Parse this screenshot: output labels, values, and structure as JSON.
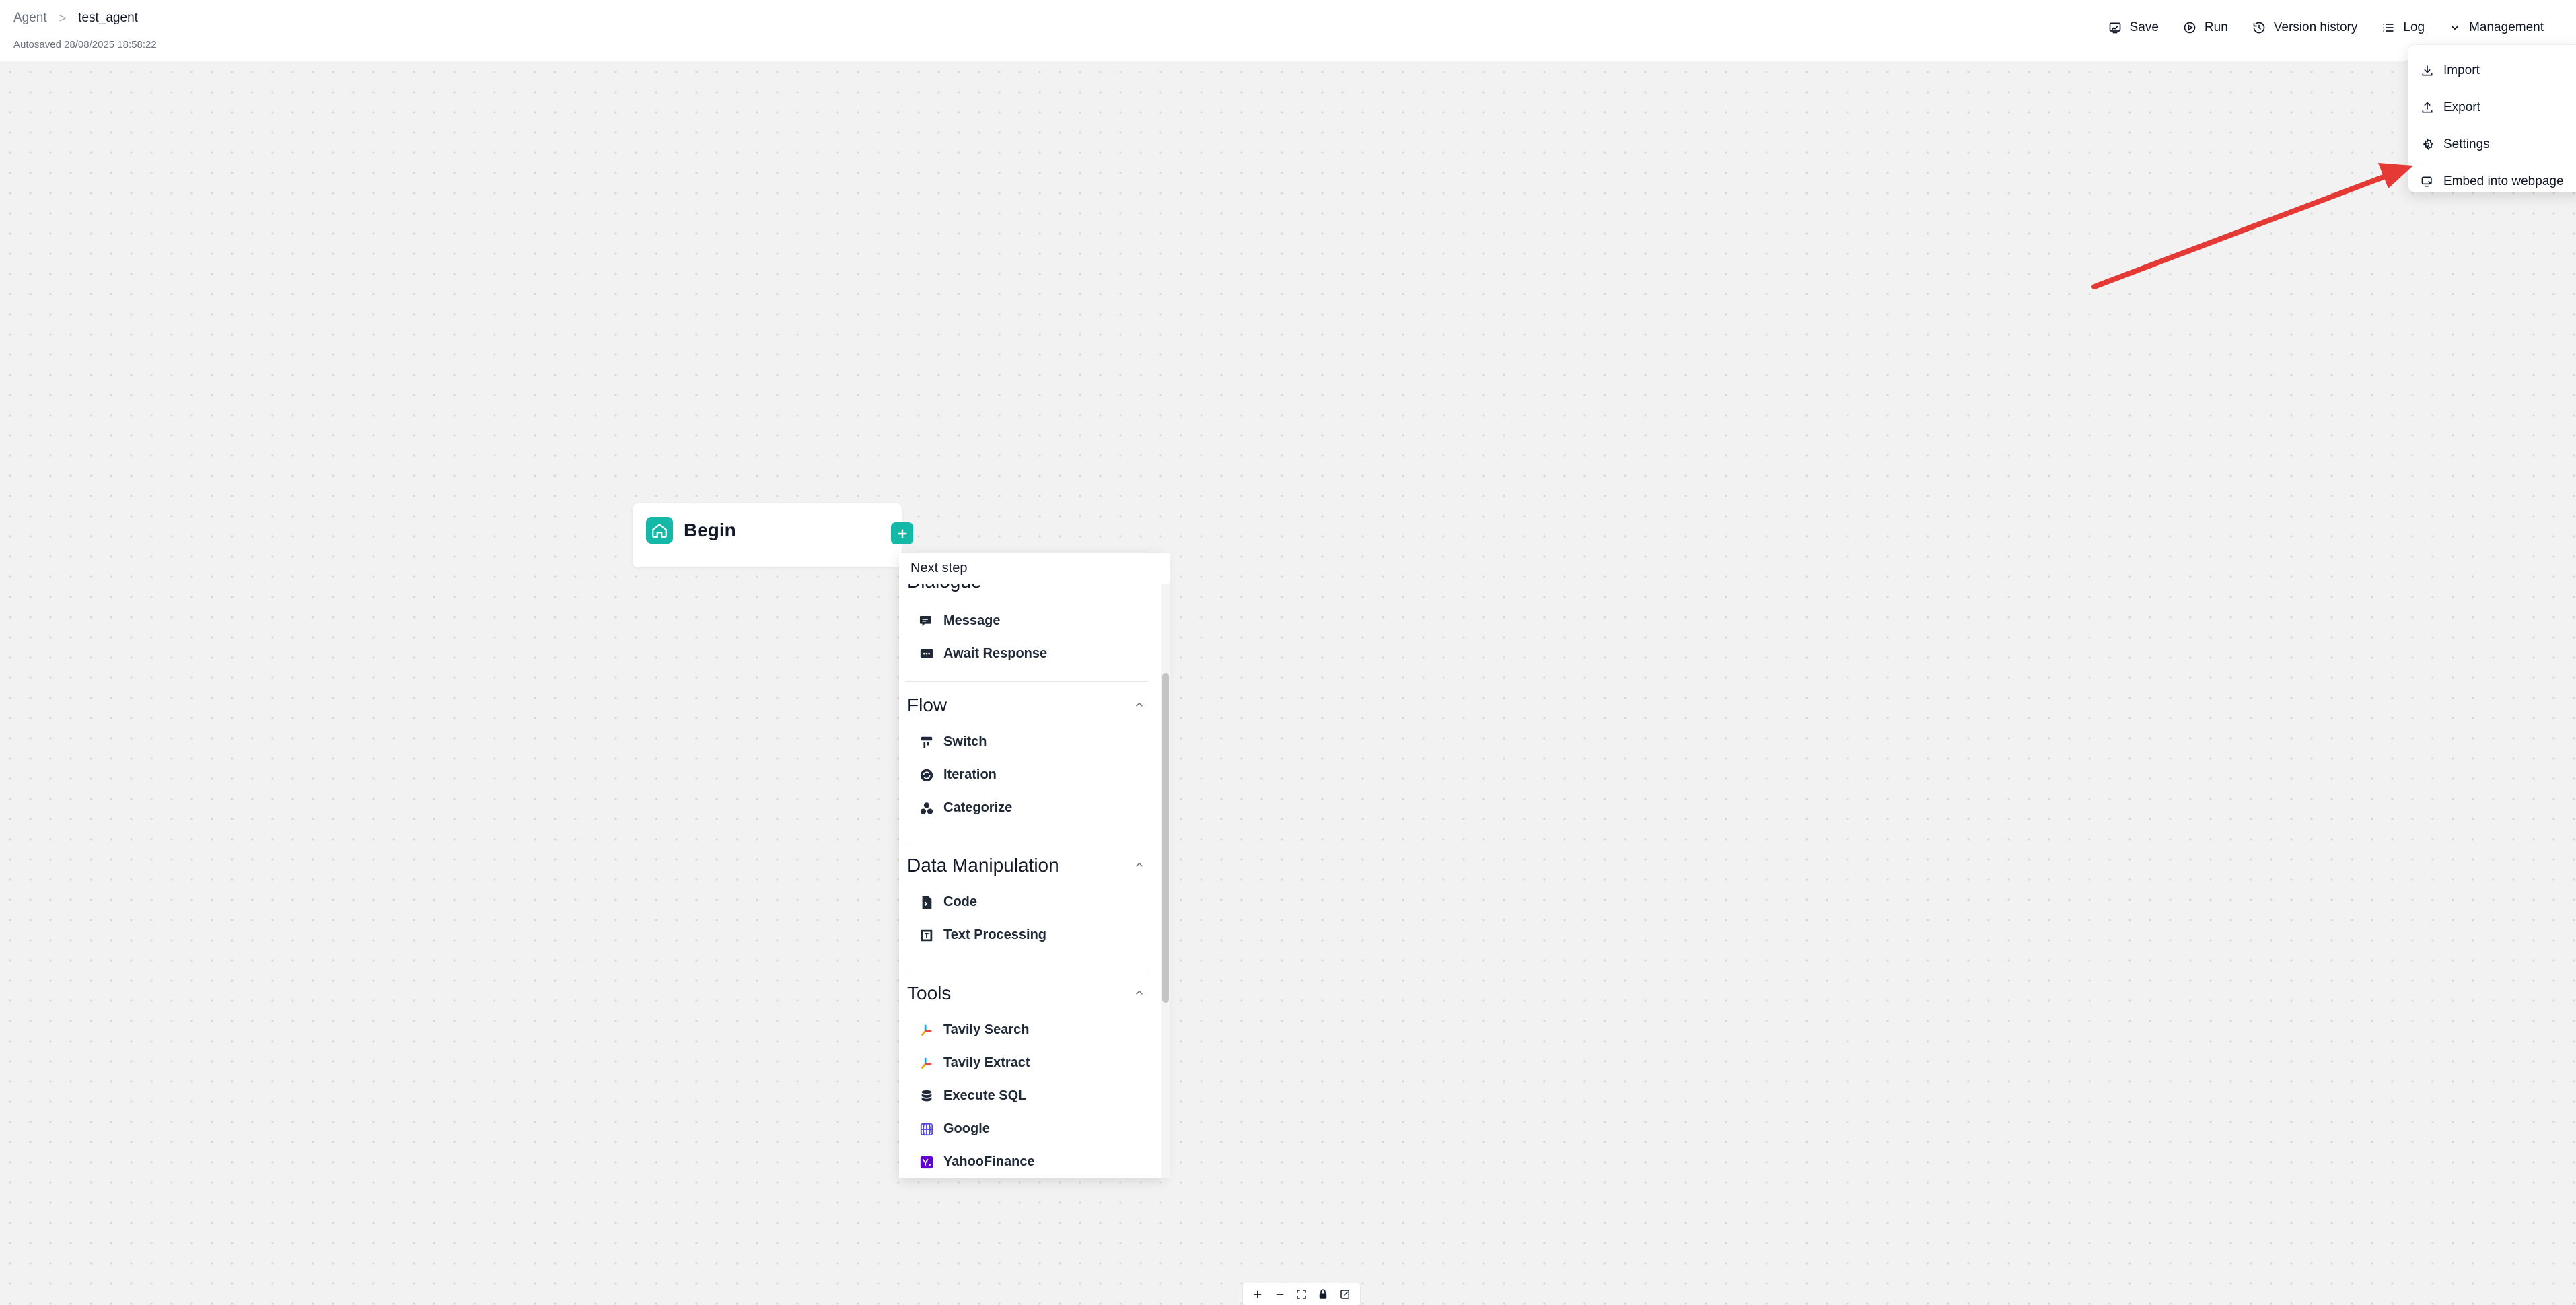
{
  "breadcrumb": {
    "root": "Agent",
    "separator": ">",
    "current": "test_agent"
  },
  "autosave": "Autosaved 28/08/2025 18:58:22",
  "toolbar": {
    "save": "Save",
    "run": "Run",
    "version_history": "Version history",
    "log": "Log",
    "management": "Management"
  },
  "management_menu": {
    "import": "Import",
    "export": "Export",
    "settings": "Settings",
    "embed": "Embed into webpage"
  },
  "begin_node": {
    "title": "Begin"
  },
  "next_step": {
    "label": "Next step",
    "partial_heading": "Dialogue",
    "dialogue_items": [
      "Message",
      "Await Response"
    ],
    "groups": {
      "flow": {
        "title": "Flow",
        "items": [
          "Switch",
          "Iteration",
          "Categorize"
        ]
      },
      "data": {
        "title": "Data Manipulation",
        "items": [
          "Code",
          "Text Processing"
        ]
      },
      "tools": {
        "title": "Tools",
        "items": [
          "Tavily Search",
          "Tavily Extract",
          "Execute SQL",
          "Google",
          "YahooFinance"
        ]
      }
    }
  },
  "colors": {
    "accent": "#14b8a6",
    "arrow": "#e53935"
  }
}
